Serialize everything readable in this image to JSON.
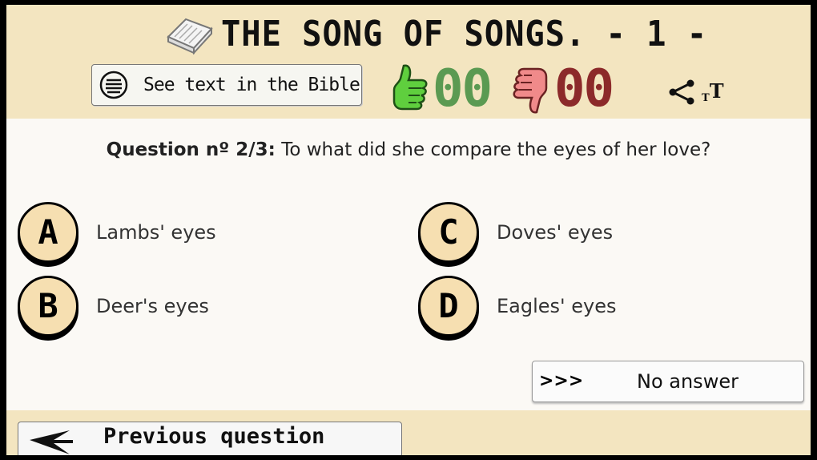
{
  "header": {
    "title": "THE SONG OF SONGS. - 1 -",
    "see_text_label": "See text in the Bible",
    "correct_count": "00",
    "wrong_count": "00",
    "icons": {
      "book": "bible-icon",
      "list": "list-icon",
      "thumbs_up": "thumbs-up-icon",
      "thumbs_down": "thumbs-down-icon",
      "share": "share-icon",
      "font_size": "font-size-icon"
    },
    "font_size_glyph_small": "T",
    "font_size_glyph_big": "T"
  },
  "question": {
    "number_label": "Question nº 2/3:",
    "text": "To what did she compare the eyes of her love?"
  },
  "answers": [
    {
      "letter": "A",
      "text": "Lambs' eyes"
    },
    {
      "letter": "B",
      "text": "Deer's eyes"
    },
    {
      "letter": "C",
      "text": "Doves' eyes"
    },
    {
      "letter": "D",
      "text": "Eagles' eyes"
    }
  ],
  "no_answer": {
    "arrows": ">>>",
    "label": "No answer"
  },
  "footer": {
    "previous_label": "Previous question"
  },
  "colors": {
    "header_bg": "#f3e5c0",
    "content_bg": "#fbf9f5",
    "answer_circle": "#f6dfb1",
    "correct": "#5b9a52",
    "wrong": "#8c2a2a",
    "thumb_up": "#5fcf3e",
    "thumb_down": "#f08a8a"
  }
}
